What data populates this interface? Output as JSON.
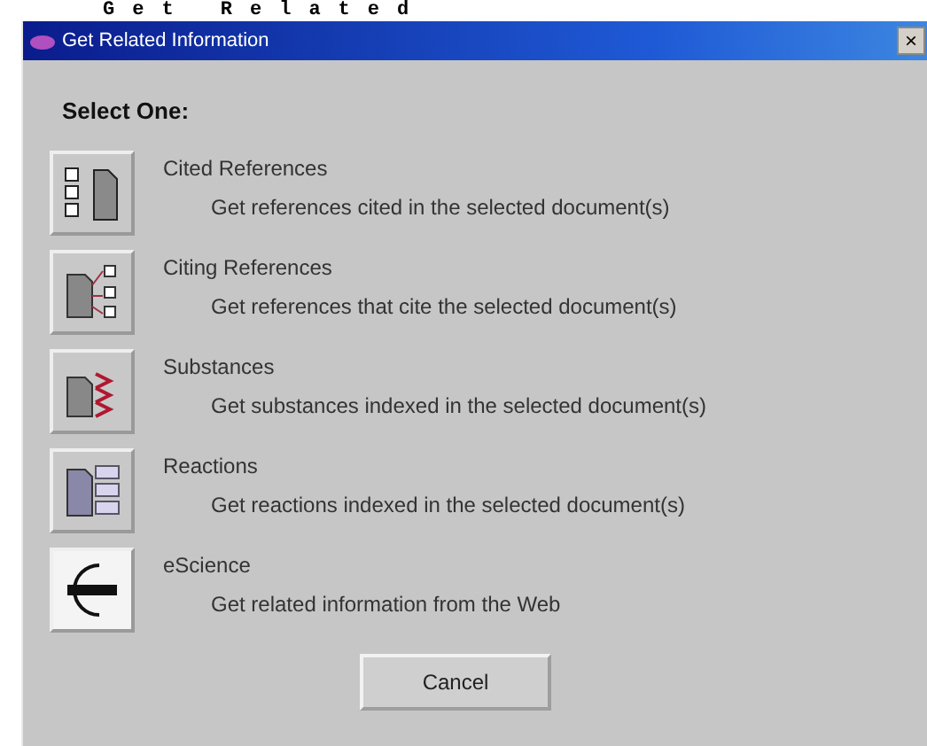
{
  "caption": "Get Related",
  "window": {
    "title": "Get Related Information",
    "close": "×"
  },
  "heading": "Select One:",
  "options": [
    {
      "kind": "cited",
      "label": "Cited References",
      "description": "Get references cited in the selected document(s)"
    },
    {
      "kind": "citing",
      "label": "Citing References",
      "description": "Get references that cite the selected document(s)"
    },
    {
      "kind": "substances",
      "label": "Substances",
      "description": "Get substances indexed in the selected document(s)"
    },
    {
      "kind": "reactions",
      "label": "Reactions",
      "description": "Get reactions indexed in the selected document(s)"
    },
    {
      "kind": "escience",
      "label": "eScience",
      "description": "Get related information from the Web"
    }
  ],
  "buttons": [
    "Cancel"
  ]
}
